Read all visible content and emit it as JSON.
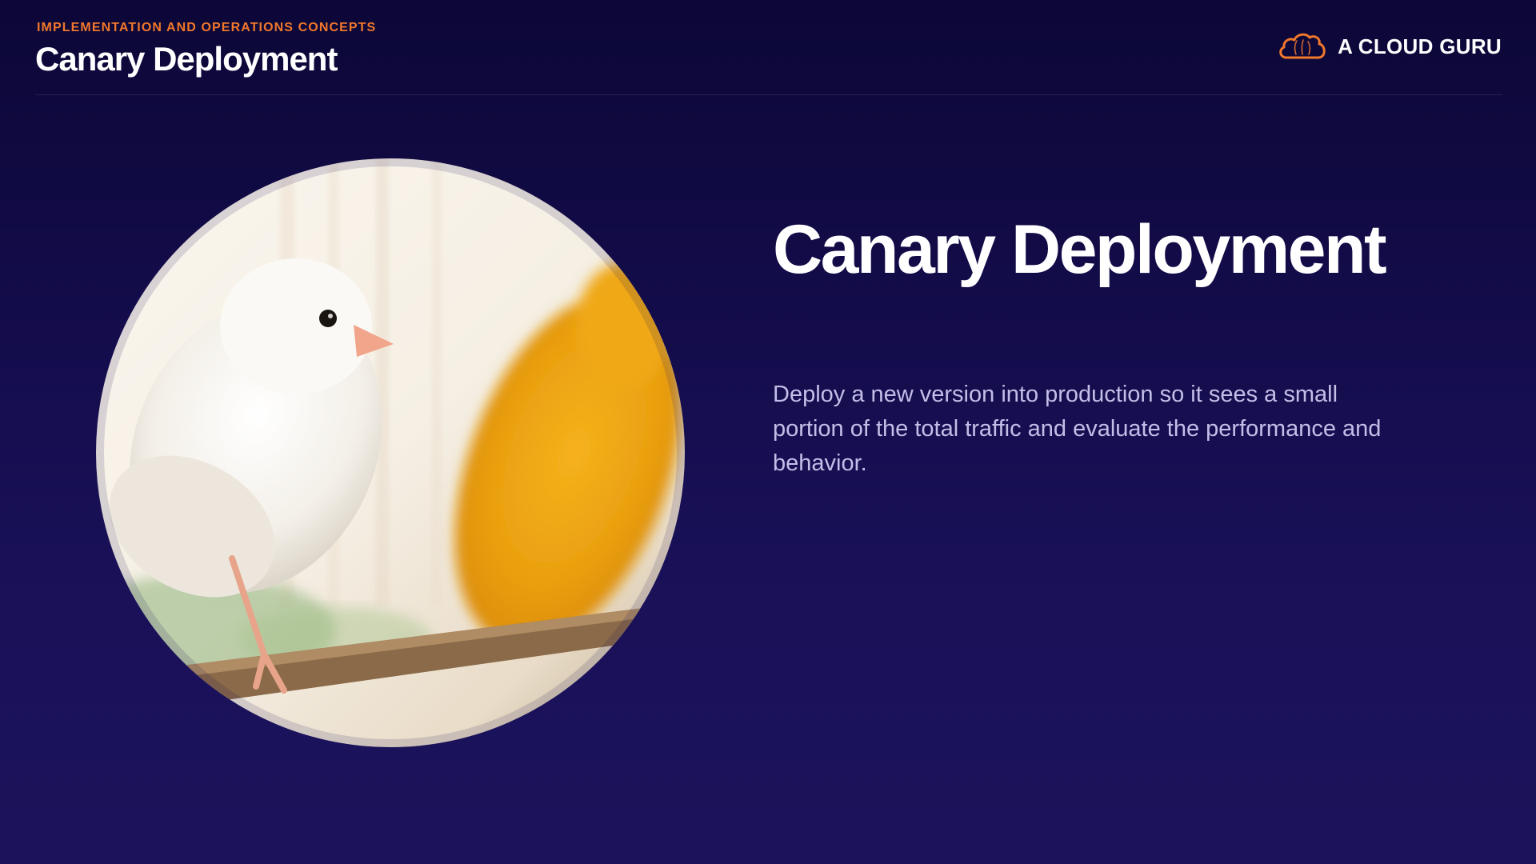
{
  "header": {
    "eyebrow": "IMPLEMENTATION AND OPERATIONS CONCEPTS",
    "title": "Canary Deployment"
  },
  "brand": {
    "name": "A CLOUD GURU",
    "icon": "cloud-icon",
    "color": "#f0772b"
  },
  "hero_image": {
    "subject": "canary-birds-photo"
  },
  "content": {
    "title": "Canary Deployment",
    "description": "Deploy a new version into production so it sees a small portion of the total traffic and evaluate the performance and behavior."
  },
  "colors": {
    "background_top": "#0c0737",
    "background_bottom": "#1b125b",
    "accent": "#f0772b",
    "text": "#ffffff",
    "muted_text": "#c3bee8"
  }
}
